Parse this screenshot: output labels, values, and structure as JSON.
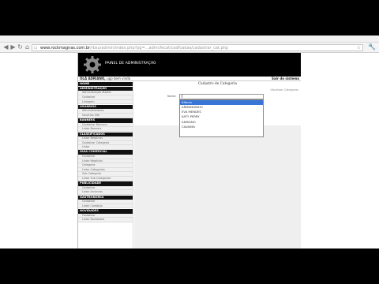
{
  "browser": {
    "url_host": "www.rockmagnas.com.br",
    "url_path": "/rbsu/admin/index.php?pg=...admcfecat/cadfcadas/cadastrar_cat.php",
    "back_glyph": "◀",
    "forward_glyph": "▶",
    "reload_glyph": "↻",
    "home_glyph": "⌂",
    "star_glyph": "☆",
    "wrench_glyph": "🔧"
  },
  "admin": {
    "title": "PAINEL DE ADMINISTRAÇÃO",
    "greeting": "OLÁ ADRIANO,",
    "greeting_link": "upp bem vindo",
    "logout": "Sair do sistema"
  },
  "sidebar": {
    "sections": [
      {
        "title": "HOME",
        "items": []
      },
      {
        "title": "ADMINISTRAÇÃO",
        "items": [
          "Administração Master",
          "Cadastrar",
          "Listagem"
        ]
      },
      {
        "title": "USUÁRIOS",
        "items": [
          "Administradores",
          "Usuários Site"
        ]
      },
      {
        "title": "BANNERS",
        "items": [
          "Cadastrar Banners",
          "Listar Banners"
        ]
      },
      {
        "title": "CLASSIFICADOS",
        "items": [
          "Listar Negócios",
          "Cadastrar Categoria",
          "Listar"
        ]
      },
      {
        "title": "GUIA COMERCIAL",
        "items": [
          "Cadastrar",
          "Listar Negócios",
          "Categoria",
          "Listar Categorias",
          "Sub Categoria",
          "Listar Sub Categorias"
        ]
      },
      {
        "title": "PUBLICIDADE",
        "items": [
          "Cadastrar",
          "Listar Anúncios"
        ]
      },
      {
        "title": "GASTRONOMIA",
        "items": [
          "Cadastrar",
          "Listar Cardápio"
        ]
      },
      {
        "title": "NOVIDADES",
        "items": [
          "Cadastrar",
          "Listar Novidades"
        ]
      }
    ]
  },
  "form": {
    "title": "Cadastro de Categoria",
    "view_link": "Visualizar Categorias",
    "name_label": "Nome:",
    "name_value": "",
    "suggestions": [
      "Álbuns",
      "ARMANDINHO",
      "EVA MENDES",
      "KATY PERRY",
      "ADRIANO",
      "CAVAIMA"
    ],
    "selected_index": 0
  }
}
